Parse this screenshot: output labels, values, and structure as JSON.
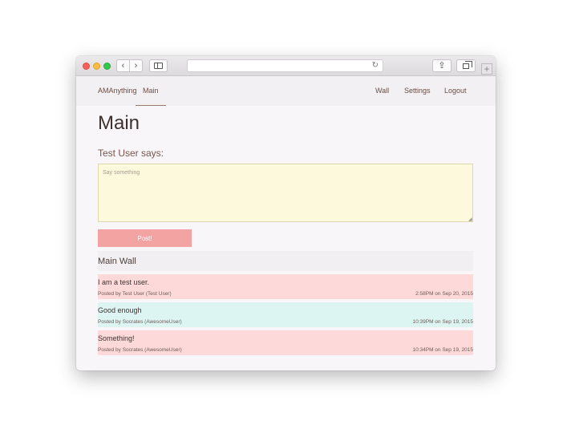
{
  "browser": {
    "nav_back": "‹",
    "nav_forward": "›",
    "reload": "↻",
    "share": "⇪",
    "new_tab": "+"
  },
  "navbar": {
    "brand": "AMAnything",
    "active": "Main",
    "links": [
      "Wall",
      "Settings",
      "Logout"
    ]
  },
  "page": {
    "title": "Main",
    "says_label": "Test User says:",
    "textarea_placeholder": "Say something",
    "post_button": "Post!"
  },
  "wall": {
    "title": "Main Wall",
    "posts": [
      {
        "message": "I am a test user.",
        "author": "Posted by Test User (Test User)",
        "time": "2:58PM on Sep 20, 2015",
        "color": "#fdd9d9"
      },
      {
        "message": "Good enough",
        "author": "Posted by Socrates (AwesomeUser)",
        "time": "10:39PM on Sep 19, 2015",
        "color": "#dcf5f3"
      },
      {
        "message": "Something!",
        "author": "Posted by Socrates (AwesomeUser)",
        "time": "10:34PM on Sep 19, 2015",
        "color": "#fdd9d9"
      }
    ]
  },
  "colors": {
    "textarea_bg": "#fdf9dc",
    "button_bg": "#f4a3a3",
    "post_pink": "#fdd9d9",
    "post_teal": "#dcf5f3"
  }
}
